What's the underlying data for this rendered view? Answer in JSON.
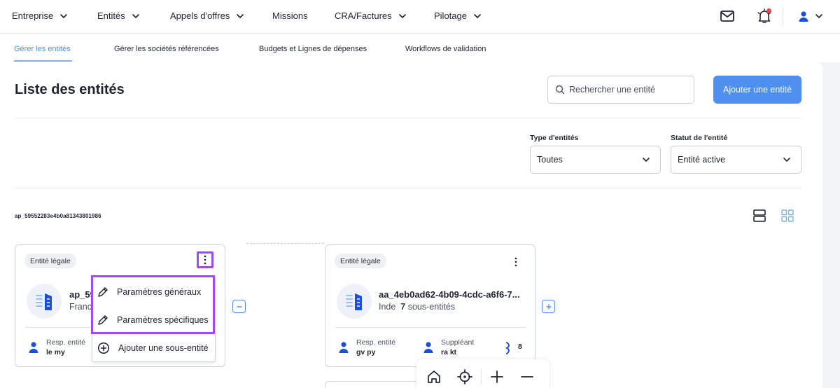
{
  "nav": {
    "items": [
      {
        "label": "Entreprise"
      },
      {
        "label": "Entités"
      },
      {
        "label": "Appels d'offres"
      },
      {
        "label": "Missions"
      },
      {
        "label": "CRA/Factures"
      },
      {
        "label": "Pilotage"
      }
    ],
    "icons": [
      "mail-icon",
      "bell-icon",
      "user-icon"
    ]
  },
  "subnav": {
    "items": [
      {
        "label": "Gérer les entités",
        "active": true
      },
      {
        "label": "Gérer les sociétés référencées"
      },
      {
        "label": "Budgets et Lignes de dépenses"
      },
      {
        "label": "Workflows de validation"
      }
    ]
  },
  "page": {
    "title": "Liste des entités",
    "search_placeholder": "Rechercher une entité",
    "add_button": "Ajouter une entité"
  },
  "filters": {
    "type": {
      "label": "Type d'entités",
      "value": "Toutes"
    },
    "status": {
      "label": "Statut de l'entité",
      "value": "Entité active"
    }
  },
  "tree": {
    "root_id": "ap_59552283e4b0a81343801986",
    "cards": [
      {
        "tag": "Entité légale",
        "name": "ap_59",
        "country": "Franc",
        "resp_label": "Resp. entité",
        "resp_value": "le my"
      },
      {
        "tag": "Entité légale",
        "name": "aa_4eb0ad62-4b09-4cdc-a6f6-7...",
        "country": "Inde",
        "sub_count": "7",
        "sub_label": "sous-entités",
        "resp_label": "Resp. entité",
        "resp_value": "gv py",
        "deputy_label": "Suppléant",
        "deputy_value": "ra kt",
        "count": "8"
      }
    ]
  },
  "context_menu": {
    "items": [
      {
        "label": "Paramètres généraux",
        "icon": "pencil-icon"
      },
      {
        "label": "Paramètres spécifiques",
        "icon": "pencil-icon"
      },
      {
        "label": "Ajouter une sous-entité",
        "icon": "plus-circle-icon"
      }
    ]
  },
  "colors": {
    "primary": "#4f8ff0",
    "highlight": "#a04bef",
    "icon_blue": "#1d4fd8"
  }
}
